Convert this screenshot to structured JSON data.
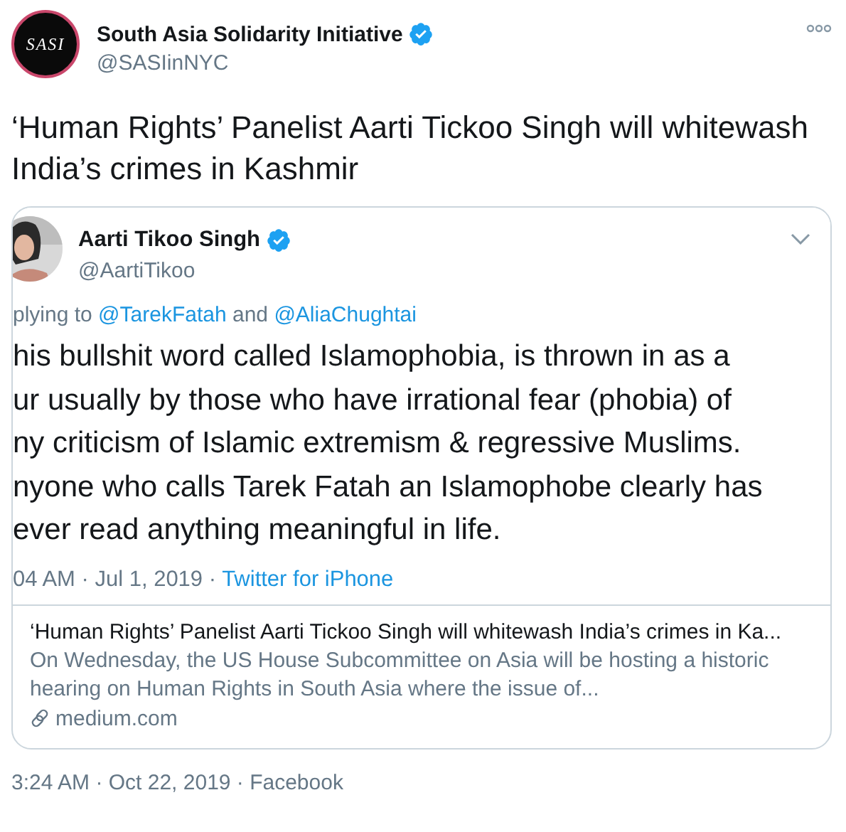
{
  "tweet": {
    "author": {
      "name": "South Asia Solidarity Initiative",
      "handle": "@SASIinNYC",
      "verified": true,
      "avatar_text": "SASI"
    },
    "text": "‘Human Rights’ Panelist Aarti Tickoo Singh will whitewash India’s crimes in Kashmir",
    "card": {
      "screenshot": {
        "author": {
          "name": "Aarti Tikoo Singh",
          "handle": "@AartiTikoo",
          "verified": true
        },
        "reply_prefix": "plying to",
        "mentions": [
          "@TarekFatah",
          "@AliaChughtai"
        ],
        "reply_joiner": "and",
        "lines": [
          "his bullshit word called Islamophobia, is thrown in as a",
          "ur usually by those who have irrational fear (phobia) of",
          "ny criticism of Islamic extremism & regressive Muslims.",
          "nyone who calls Tarek Fatah an Islamophobe clearly has",
          "ever read anything meaningful in life."
        ],
        "meta": "04 AM · Jul 1, 2019 ·",
        "source": "Twitter for iPhone"
      },
      "title": "‘Human Rights’ Panelist Aarti Tickoo Singh will whitewash India’s crimes in Ka...",
      "description": "On Wednesday, the US House Subcommittee on Asia will be hosting a historic hearing on Human Rights in South Asia where the issue of...",
      "domain": "medium.com"
    },
    "timestamp": "3:24 AM · Oct 22, 2019 · Facebook"
  }
}
